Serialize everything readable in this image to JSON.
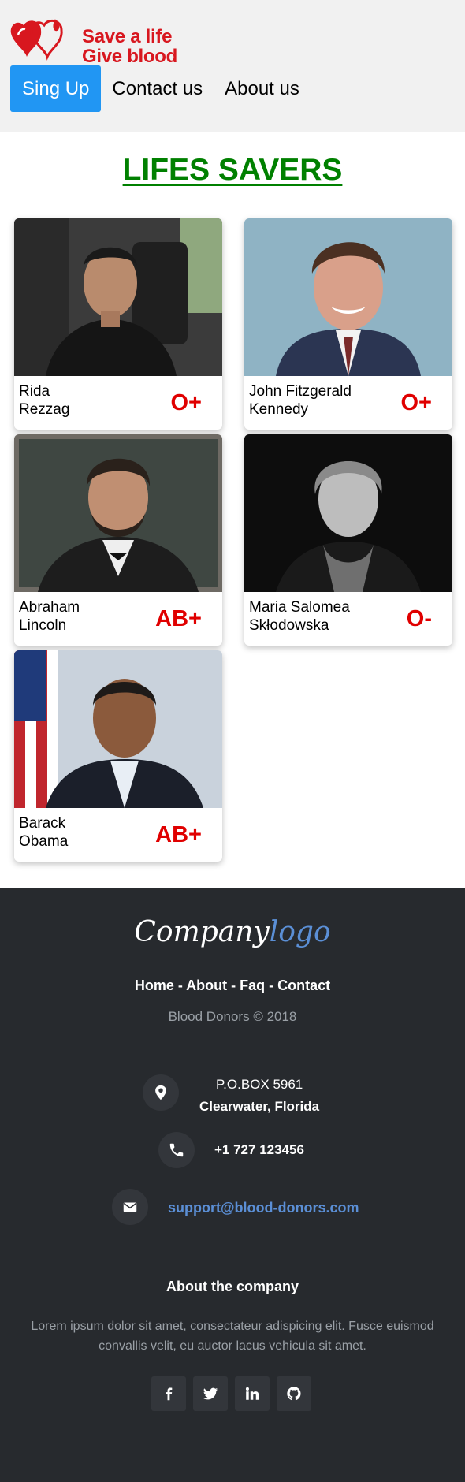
{
  "header": {
    "logo_line1": "Save a life",
    "logo_line2": "Give blood",
    "nav": [
      {
        "label": "Sing Up",
        "active": true
      },
      {
        "label": "Contact us",
        "active": false
      },
      {
        "label": "About us",
        "active": false
      }
    ]
  },
  "main": {
    "title": "LIFES SAVERS",
    "donors": [
      {
        "first": "Rida",
        "last": "Rezzag",
        "blood": "O+"
      },
      {
        "first": "John Fitzgerald",
        "last": "Kennedy",
        "blood": "O+"
      },
      {
        "first": "Abraham",
        "last": "Lincoln",
        "blood": "AB+"
      },
      {
        "first": "Maria Salomea",
        "last": "Skłodowska",
        "blood": "O-"
      },
      {
        "first": "Barack",
        "last": "Obama",
        "blood": "AB+"
      }
    ]
  },
  "footer": {
    "logo_a": "Company",
    "logo_b": "logo",
    "links": "Home - About - Faq - Contact",
    "copyright": "Blood Donors © 2018",
    "address_line1": "P.O.BOX 5961",
    "address_line2": "Clearwater, Florida",
    "phone": "+1 727 123456",
    "email": "support@blood-donors.com",
    "about_title": "About the company",
    "about_text": "Lorem ipsum dolor sit amet, consectateur adispicing elit. Fusce euismod convallis velit, eu auctor lacus vehicula sit amet.",
    "social_icons": [
      "facebook-icon",
      "twitter-icon",
      "linkedin-icon",
      "github-icon"
    ]
  },
  "colors": {
    "brand_red": "#d8171f",
    "nav_active": "#2196f3",
    "title_green": "#008000",
    "blood_red": "#e00000",
    "footer_bg": "#272a2e",
    "link_blue": "#5b8fd6"
  }
}
